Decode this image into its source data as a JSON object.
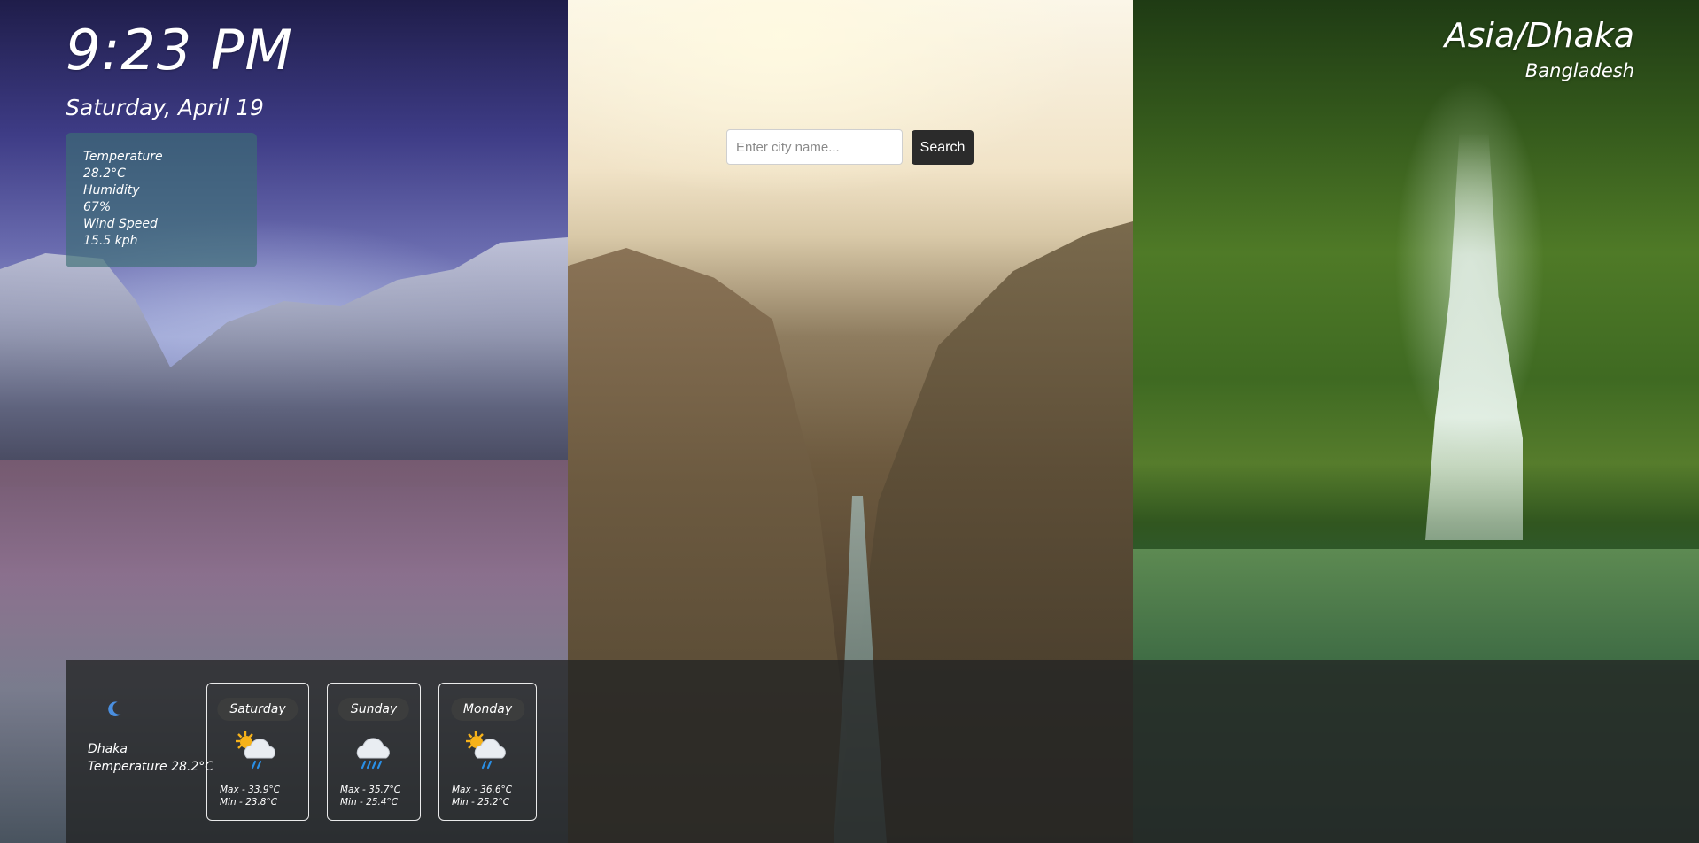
{
  "clock": {
    "time": "9:23 PM",
    "date": "Saturday, April 19"
  },
  "weather_card": {
    "temperature_label": "Temperature",
    "temperature_value": "28.2°C",
    "humidity_label": "Humidity",
    "humidity_value": "67%",
    "wind_label": "Wind Speed",
    "wind_value": "15.5 kph"
  },
  "search": {
    "placeholder": "Enter city name...",
    "button_label": "Search"
  },
  "location": {
    "timezone": "Asia/Dhaka",
    "country": "Bangladesh"
  },
  "current": {
    "icon": "moon-icon",
    "city": "Dhaka",
    "temperature": "Temperature 28.2°C"
  },
  "forecast": [
    {
      "day": "Saturday",
      "icon": "sun-cloud-rain-icon",
      "max": "Max - 33.9°C",
      "min": "Min - 23.8°C"
    },
    {
      "day": "Sunday",
      "icon": "cloud-rain-icon",
      "max": "Max - 35.7°C",
      "min": "Min - 25.4°C"
    },
    {
      "day": "Monday",
      "icon": "sun-cloud-rain-icon",
      "max": "Max - 36.6°C",
      "min": "Min - 25.2°C"
    }
  ],
  "colors": {
    "card_bg": "#3c6e73",
    "button_bg": "#2b2b2b",
    "bar_bg": "#232424"
  }
}
